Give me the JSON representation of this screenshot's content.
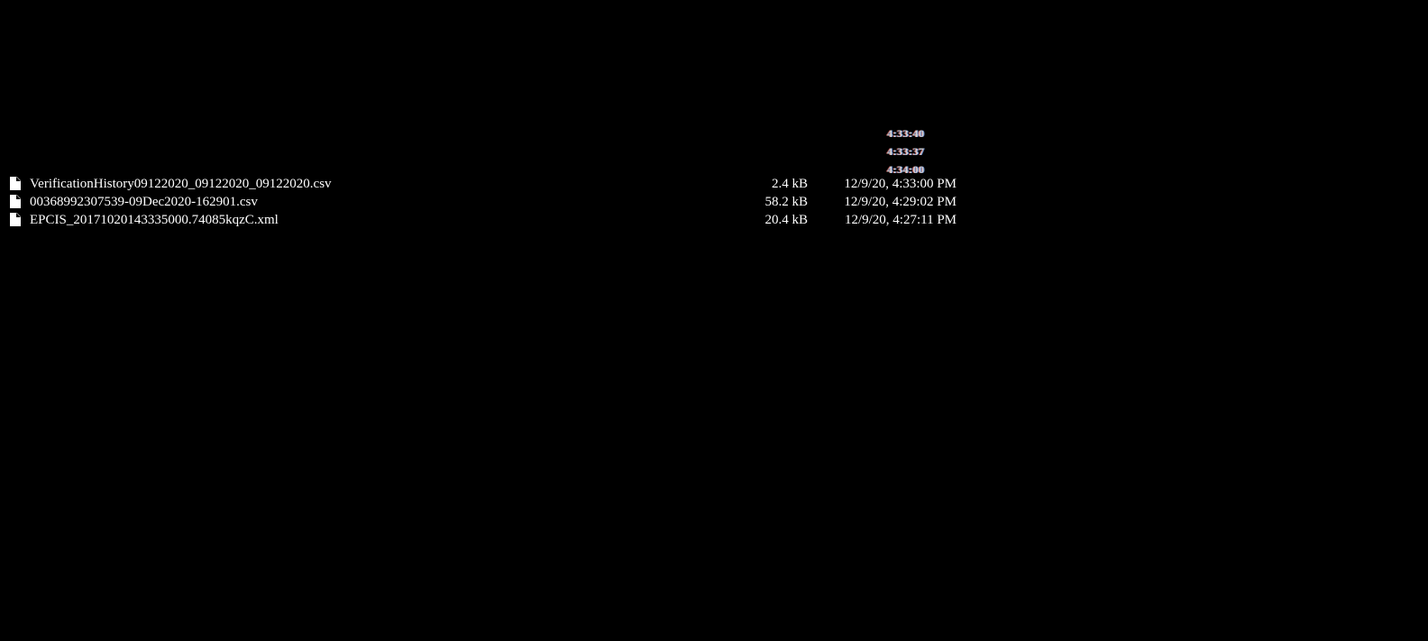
{
  "ghost_times": [
    {
      "text": "4:33:40"
    },
    {
      "text": "4:33:37"
    },
    {
      "text": "4:34:00"
    }
  ],
  "files": [
    {
      "icon": "file-icon",
      "name": "VerificationHistory09122020_09122020_09122020.csv",
      "size": "2.4 kB",
      "modified": "12/9/20, 4:33:00 PM"
    },
    {
      "icon": "file-icon",
      "name": "00368992307539-09Dec2020-162901.csv",
      "size": "58.2 kB",
      "modified": "12/9/20, 4:29:02 PM"
    },
    {
      "icon": "file-icon",
      "name": "EPCIS_20171020143335000.74085kqzC.xml",
      "size": "20.4 kB",
      "modified": "12/9/20, 4:27:11 PM"
    }
  ],
  "colors": {
    "background": "#000000",
    "text": "#ffffff"
  }
}
